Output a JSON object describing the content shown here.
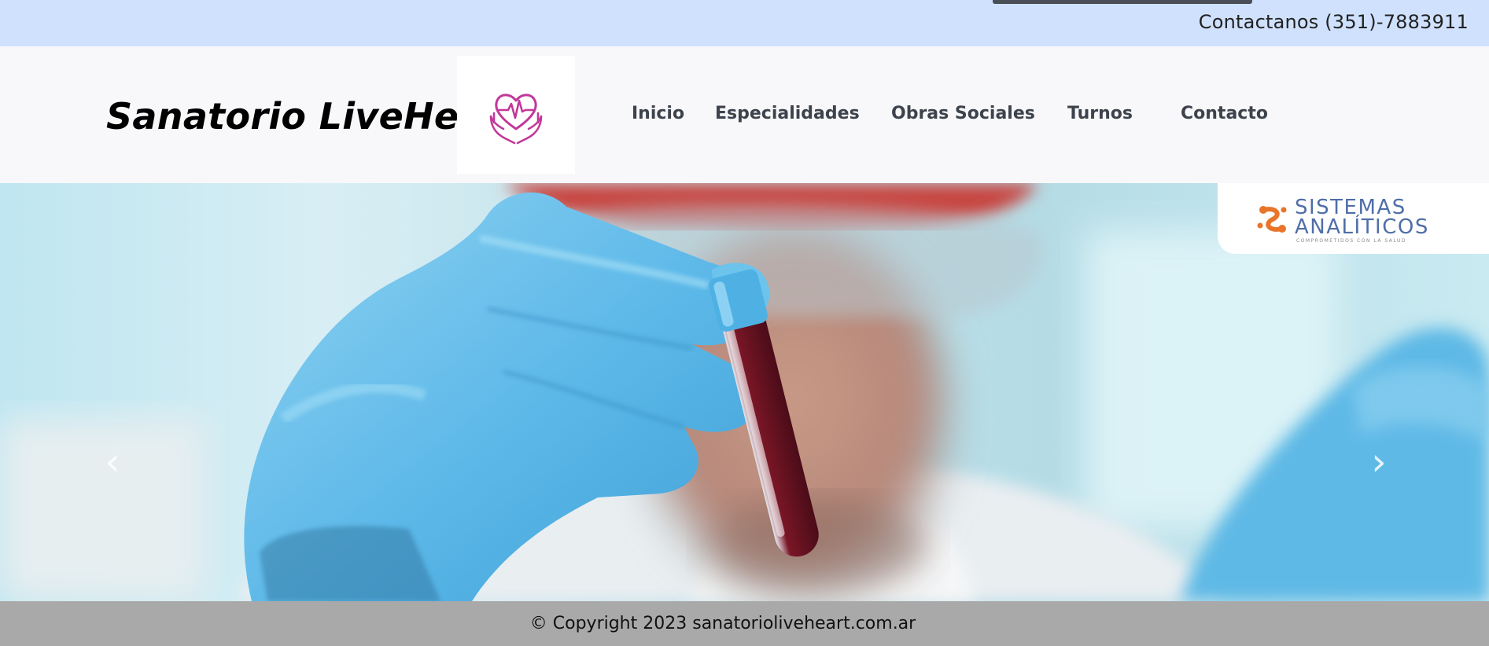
{
  "topbar": {
    "contact_text": "Contactanos (351)-7883911"
  },
  "header": {
    "brand_title": "Sanatorio LiveHeart",
    "logo_icon": "heart-pulse-hands-icon",
    "nav": {
      "inicio": "Inicio",
      "especialidades": "Especialidades",
      "obras_sociales": "Obras Sociales",
      "turnos": "Turnos",
      "contacto": "Contacto"
    }
  },
  "hero": {
    "image_subject": "lab technician in blue gloves holding blood test tube",
    "prev_icon": "chevron-left-icon",
    "next_icon": "chevron-right-icon",
    "prev_glyph": "‹",
    "next_glyph": "›",
    "sponsor": {
      "line1": "SISTEMAS",
      "line2": "ANALÍTICOS",
      "tagline": "COMPROMETIDOS CON LA SALUD"
    }
  },
  "footer": {
    "copyright": "© Copyright 2023 sanatorioliveheart.com.ar"
  },
  "colors": {
    "topbar_bg": "#cfe1fd",
    "header_bg": "#f8f8fa",
    "nav_text": "#3d434c",
    "logo_accent": "#c2389a",
    "footer_bg": "#a9a9a9",
    "sponsor_blue": "#4f6ea8",
    "sponsor_orange": "#e8752a"
  }
}
